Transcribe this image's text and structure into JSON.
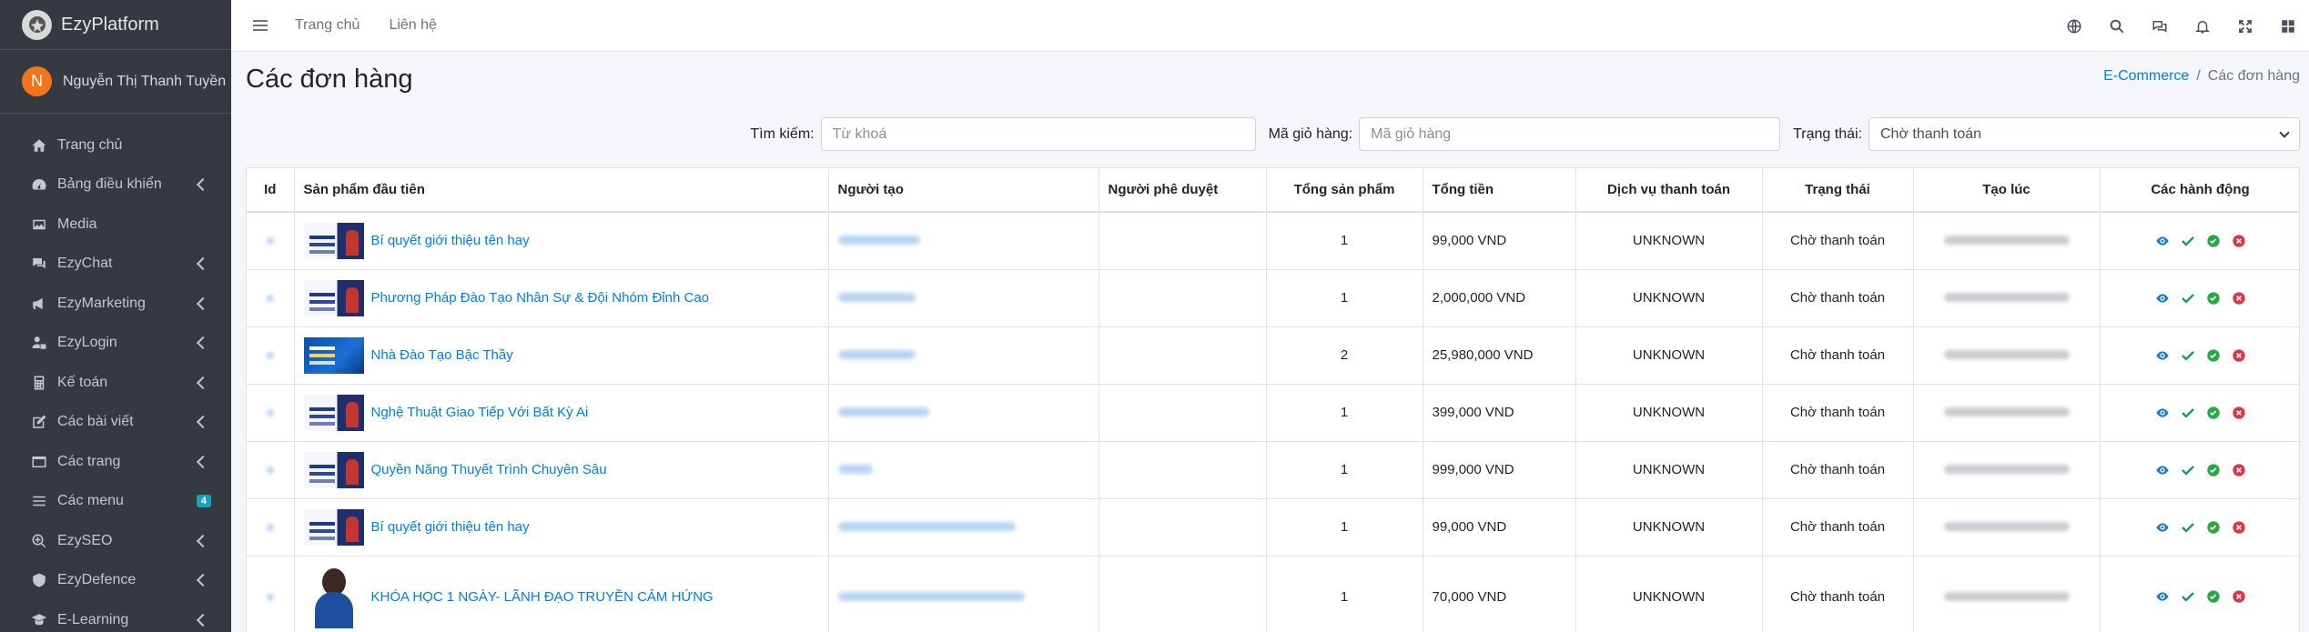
{
  "brand": {
    "name": "EzyPlatform"
  },
  "user": {
    "initial": "N",
    "name": "Nguyễn Thị Thanh Tuyền"
  },
  "sidebar": {
    "items": [
      {
        "label": "Trang chủ",
        "icon": "home-icon"
      },
      {
        "label": "Bảng điều khiển",
        "icon": "dashboard-icon"
      },
      {
        "label": "Media",
        "icon": "image-icon"
      },
      {
        "label": "EzyChat",
        "icon": "chat-icon"
      },
      {
        "label": "EzyMarketing",
        "icon": "megaphone-icon"
      },
      {
        "label": "EzyLogin",
        "icon": "user-lock-icon"
      },
      {
        "label": "Kế toán",
        "icon": "calculator-icon"
      },
      {
        "label": "Các bài viết",
        "icon": "edit-icon"
      },
      {
        "label": "Các trang",
        "icon": "window-icon"
      },
      {
        "label": "Các menu",
        "icon": "bars-icon",
        "badge": "4"
      },
      {
        "label": "EzySEO",
        "icon": "search-plus-icon"
      },
      {
        "label": "EzyDefence",
        "icon": "shield-icon"
      },
      {
        "label": "E-Learning",
        "icon": "graduation-cap-icon"
      }
    ]
  },
  "topbar": {
    "links": [
      "Trang chủ",
      "Liên hệ"
    ],
    "icons": [
      "globe-icon",
      "search-icon",
      "comments-icon",
      "bell-icon",
      "fullscreen-icon",
      "apps-grid-icon"
    ]
  },
  "page": {
    "title": "Các đơn hàng",
    "breadcrumb": {
      "parent": "E-Commerce",
      "current": "Các đơn hàng"
    }
  },
  "filters": {
    "search_label": "Tìm kiếm:",
    "search_placeholder": "Từ khoá",
    "cart_label": "Mã giỏ hàng:",
    "cart_placeholder": "Mã giỏ hàng",
    "status_label": "Trạng thái:",
    "status_value": "Chờ thanh toán"
  },
  "table": {
    "headers": [
      "Id",
      "Sản phẩm đầu tiên",
      "Người tạo",
      "Người phê duyệt",
      "Tổng sản phẩm",
      "Tổng tiền",
      "Dịch vụ thanh toán",
      "Trạng thái",
      "Tạo lúc",
      "Các hành động"
    ],
    "rows": [
      {
        "product": "Bí quyết giới thiệu tên hay",
        "total_items": "1",
        "total": "99,000 VND",
        "payment": "UNKNOWN",
        "status": "Chờ thanh toán"
      },
      {
        "product": "Phương Pháp Đào Tạo Nhân Sự & Đội Nhóm Đỉnh Cao",
        "total_items": "1",
        "total": "2,000,000 VND",
        "payment": "UNKNOWN",
        "status": "Chờ thanh toán"
      },
      {
        "product": "Nhà Đào Tạo Bậc Thầy",
        "total_items": "2",
        "total": "25,980,000 VND",
        "payment": "UNKNOWN",
        "status": "Chờ thanh toán"
      },
      {
        "product": "Nghệ Thuật Giao Tiếp Với Bất Kỳ Ai",
        "total_items": "1",
        "total": "399,000 VND",
        "payment": "UNKNOWN",
        "status": "Chờ thanh toán"
      },
      {
        "product": "Quyền Năng Thuyết Trình Chuyên Sâu",
        "total_items": "1",
        "total": "999,000 VND",
        "payment": "UNKNOWN",
        "status": "Chờ thanh toán"
      },
      {
        "product": "Bí quyết giới thiệu tên hay",
        "total_items": "1",
        "total": "99,000 VND",
        "payment": "UNKNOWN",
        "status": "Chờ thanh toán"
      },
      {
        "product": "KHÓA HỌC 1 NGÀY- LÃNH ĐẠO TRUYỀN CẢM HỨNG",
        "total_items": "1",
        "total": "70,000 VND",
        "payment": "UNKNOWN",
        "status": "Chờ thanh toán"
      }
    ]
  },
  "colors": {
    "sidebar_bg": "#343a40",
    "link": "#007bff",
    "view": "#1e7ac9",
    "check": "#13967a",
    "approve": "#28a745",
    "delete": "#dc3545"
  }
}
